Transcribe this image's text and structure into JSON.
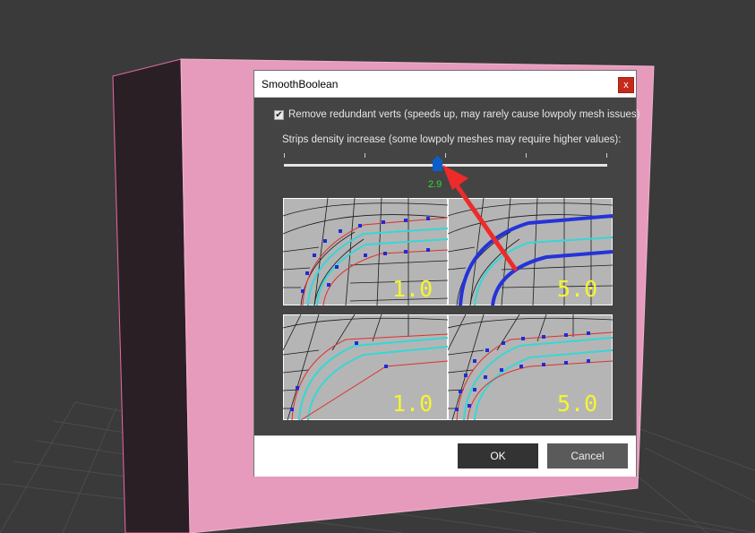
{
  "dialog": {
    "title": "SmoothBoolean",
    "close_glyph": "x",
    "checkbox": {
      "checked": true,
      "label": "Remove redundant verts (speeds up, may rarely cause lowpoly mesh issues)"
    },
    "slider": {
      "label": "Strips density increase (some lowpoly meshes may require higher values):",
      "value": "2.9"
    },
    "previews": [
      {
        "label": "1.0"
      },
      {
        "label": "5.0"
      },
      {
        "label": "1.0"
      },
      {
        "label": "5.0"
      }
    ],
    "ok_label": "OK",
    "cancel_label": "Cancel"
  },
  "colors": {
    "cube_pink": "#e69bbd",
    "dialog_bg": "#444444",
    "value_green": "#2fdc2f",
    "arrow_red": "#ee2a2a",
    "accent_blue": "#0b5fc9"
  },
  "icons": [
    "close-icon",
    "checkmark-icon",
    "slider-thumb-icon",
    "red-arrow-annotation"
  ]
}
